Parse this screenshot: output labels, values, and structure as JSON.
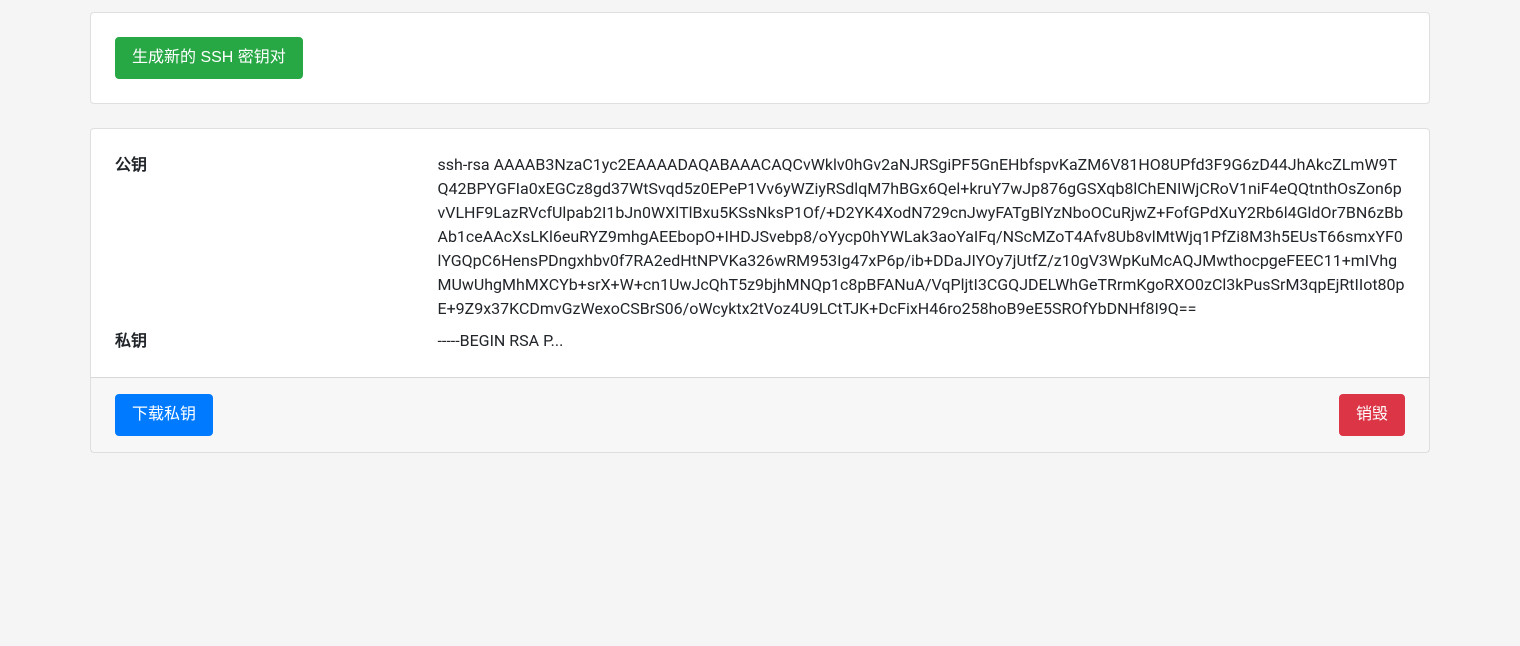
{
  "topCard": {
    "generateButton": "生成新的 SSH 密钥对"
  },
  "keyCard": {
    "publicKeyLabel": "公钥",
    "publicKeyValue": "ssh-rsa AAAAB3NzaC1yc2EAAAADAQABAAACAQCvWklv0hGv2aNJRSgiPF5GnEHbfspvKaZM6V81HO8UPfd3F9G6zD44JhAkcZLmW9TQ42BPYGFIa0xEGCz8gd37WtSvqd5z0EPeP1Vv6yWZiyRSdlqM7hBGx6Qel+kruY7wJp876gGSXqb8lChENIWjCRoV1niF4eQQtnthOsZon6pvVLHF9LazRVcfUlpab2I1bJn0WXlTlBxu5KSsNksP1Of/+D2YK4XodN729cnJwyFATgBlYzNboOCuRjwZ+FofGPdXuY2Rb6l4GldOr7BN6zBbAb1ceAAcXsLKl6euRYZ9mhgAEEbopO+IHDJSvebp8/oYycp0hYWLak3aoYaIFq/NScMZoT4Afv8Ub8vlMtWjq1PfZi8M3h5EUsT66smxYF0lYGQpC6HensPDngxhbv0f7RA2edHtNPVKa326wRM953Ig47xP6p/ib+DDaJIYOy7jUtfZ/z10gV3WpKuMcAQJMwthocpgeFEEC11+mIVhgMUwUhgMhMXCYb+srX+W+cn1UwJcQhT5z9bjhMNQp1c8pBFANuA/VqPljtI3CGQJDELWhGeTRrmKgoRXO0zCl3kPusSrM3qpEjRtIIot80pE+9Z9x37KCDmvGzWexoCSBrS06/oWcyktx2tVoz4U9LCtTJK+DcFixH46ro258hoB9eE5SROfYbDNHf8I9Q==",
    "privateKeyLabel": "私钥",
    "privateKeyValue": "-----BEGIN RSA P..."
  },
  "footer": {
    "downloadButton": "下载私钥",
    "destroyButton": "销毁"
  }
}
